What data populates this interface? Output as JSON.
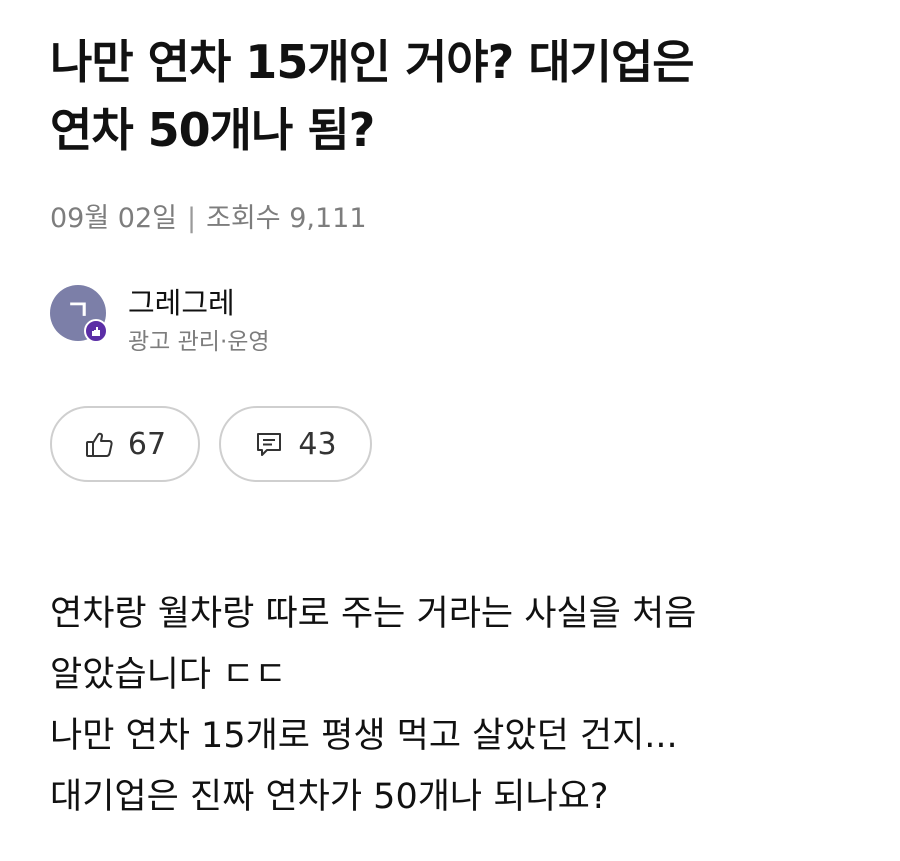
{
  "post": {
    "title_line1": "나만 연차 15개인 거야? 대기업은",
    "title_line2": "연차 50개나 됨?",
    "date": "09월 02일",
    "separator": "|",
    "views": "조회수 9,111"
  },
  "author": {
    "avatar_initial": "ㄱ",
    "name": "그레그레",
    "role": "광고 관리·운영"
  },
  "actions": {
    "like_icon": "thumbs-up-icon",
    "like_count": "67",
    "comment_icon": "comment-icon",
    "comment_count": "43"
  },
  "body": {
    "lines": [
      "연차랑 월차랑 따로 주는 거라는 사실을 처음",
      "알았습니다 ㄷㄷ",
      "나만 연차 15개로 평생 먹고 살았던 건지...",
      "대기업은 진짜 연차가 50개나 되나요?"
    ]
  },
  "colors": {
    "text": "#111111",
    "muted": "#7d7d7d",
    "border": "#cfcfcf",
    "avatar": "#7c7fa8",
    "badge": "#5b2ea6"
  }
}
